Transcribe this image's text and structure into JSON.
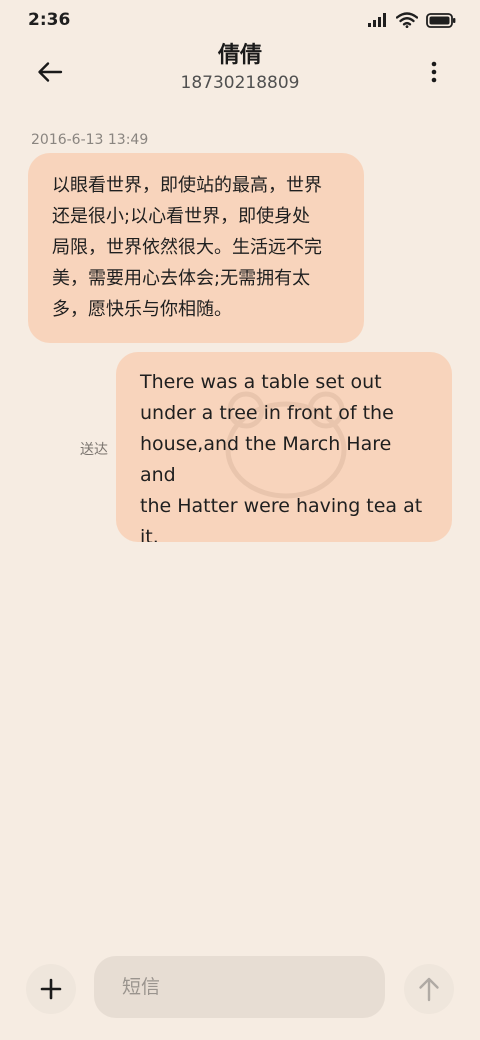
{
  "status_bar": {
    "time": "2:36"
  },
  "header": {
    "name": "倩倩",
    "number": "18730218809"
  },
  "messages": [
    {
      "direction": "incoming",
      "timestamp": "2016-6-13 13:49",
      "lines": [
        "以眼看世界，即使站的最高，世界",
        "还是很小;以心看世界，即使身处",
        "局限，世界依然很大。生活远不完",
        "美，需要用心去体会;无需拥有太",
        "多，愿快乐与你相随。"
      ]
    },
    {
      "direction": "outgoing",
      "status": "送达",
      "lines": [
        "There was a table set out",
        "under a tree in front of the",
        "house,and the March Hare and",
        "the Hatter were having tea at",
        "it."
      ]
    }
  ],
  "composer": {
    "placeholder": "短信"
  },
  "colors": {
    "background": "#F6ECE2",
    "bubble": "#F8D4BC",
    "input": "#E7DDD3"
  },
  "icons": {
    "back": "arrow-left-icon",
    "more": "more-vertical-icon",
    "add": "plus-icon",
    "send": "arrow-up-icon",
    "signal": "signal-icon",
    "wifi": "wifi-icon",
    "battery": "battery-icon"
  }
}
